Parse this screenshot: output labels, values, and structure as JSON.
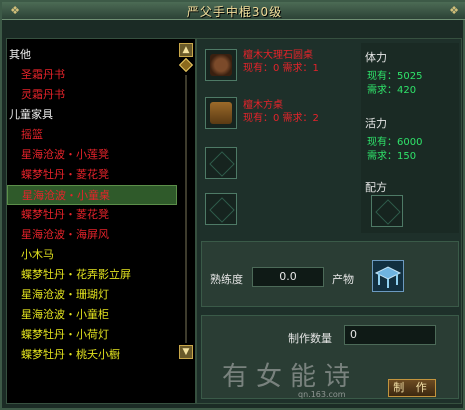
{
  "window": {
    "title": "严父手中棍30级"
  },
  "list": [
    {
      "label": "其他",
      "kind": "cat"
    },
    {
      "label": "圣霜丹书",
      "kind": "red"
    },
    {
      "label": "灵霜丹书",
      "kind": "red"
    },
    {
      "label": "儿童家具",
      "kind": "cat"
    },
    {
      "label": "摇篮",
      "kind": "red"
    },
    {
      "label": "星海沧波・小莲凳",
      "kind": "red"
    },
    {
      "label": "蝶梦牡丹・菱花凳",
      "kind": "red"
    },
    {
      "label": "星海沧波・小童桌",
      "kind": "red",
      "selected": true
    },
    {
      "label": "蝶梦牡丹・菱花凳",
      "kind": "red"
    },
    {
      "label": "星海沧波・海屏风",
      "kind": "red"
    },
    {
      "label": "小木马",
      "kind": "yellow"
    },
    {
      "label": "蝶梦牡丹・花弄影立屏",
      "kind": "yellow"
    },
    {
      "label": "星海沧波・珊瑚灯",
      "kind": "yellow"
    },
    {
      "label": "星海沧波・小童柜",
      "kind": "yellow"
    },
    {
      "label": "蝶梦牡丹・小荷灯",
      "kind": "yellow"
    },
    {
      "label": "蝶梦牡丹・桃夭小橱",
      "kind": "yellow"
    }
  ],
  "materials": [
    {
      "name": "檀木大理石圆桌",
      "have": "现有：0  需求：1"
    },
    {
      "name": "檀木方桌",
      "have": "现有：0  需求：2"
    }
  ],
  "stats": {
    "stamina_label": "体力",
    "stamina_have": "现有：5025",
    "stamina_need": "需求：420",
    "vitality_label": "活力",
    "vitality_have": "现有：6000",
    "vitality_need": "需求：150",
    "formula_label": "配方"
  },
  "production": {
    "proficiency_label": "熟练度",
    "proficiency_value": "0.0",
    "product_label": "产物"
  },
  "make": {
    "quantity_label": "制作数量",
    "quantity_value": "0",
    "button_label": "制 作"
  },
  "watermark": {
    "text": "有女能诗",
    "sub": "qn.163.com"
  }
}
